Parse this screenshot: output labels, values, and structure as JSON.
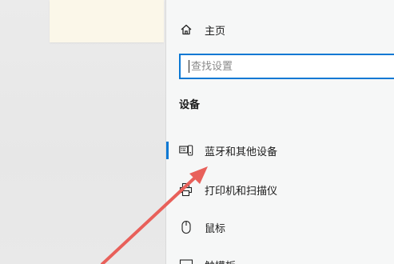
{
  "settings": {
    "home_label": "主页",
    "search": {
      "placeholder": "查找设置"
    },
    "section_title": "设备",
    "items": [
      {
        "label": "蓝牙和其他设备",
        "icon": "bluetooth-devices-icon",
        "active": true
      },
      {
        "label": "打印机和扫描仪",
        "icon": "printer-icon",
        "active": false
      },
      {
        "label": "鼠标",
        "icon": "mouse-icon",
        "active": false
      },
      {
        "label": "触摸板",
        "icon": "touchpad-icon",
        "active": false
      }
    ]
  },
  "colors": {
    "accent": "#0a78d4",
    "annotation_arrow": "#e8605a"
  }
}
